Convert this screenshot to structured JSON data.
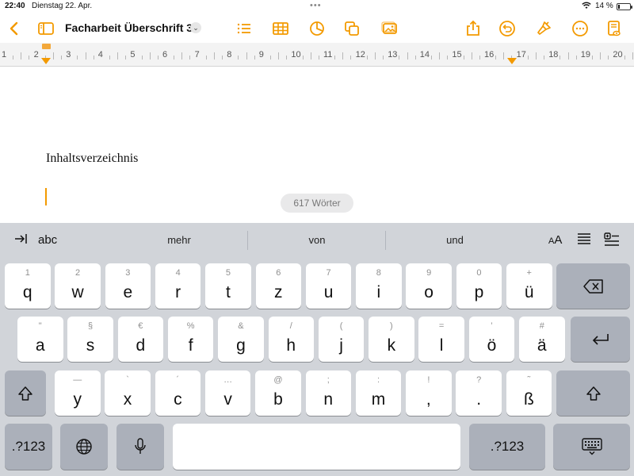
{
  "status": {
    "time": "22:40",
    "date": "Dienstag 22. Apr.",
    "battery": "14 %",
    "battery_level": 0.14
  },
  "toolbar": {
    "doc_title": "Facharbeit Überschrift 3"
  },
  "ruler": {
    "numbers": [
      "1",
      "2",
      "3",
      "4",
      "5",
      "6",
      "7",
      "8",
      "9",
      "10",
      "11",
      "12",
      "13",
      "14",
      "15",
      "16",
      "17",
      "18",
      "19",
      "20"
    ]
  },
  "document": {
    "heading": "Inhaltsverzeichnis",
    "word_count": "617 Wörter"
  },
  "keyboard": {
    "predict": {
      "abc": "abc",
      "suggestions": [
        "mehr",
        "von",
        "und"
      ],
      "font_size_label": "AA"
    },
    "row1": [
      {
        "hint": "1",
        "main": "q"
      },
      {
        "hint": "2",
        "main": "w"
      },
      {
        "hint": "3",
        "main": "e"
      },
      {
        "hint": "4",
        "main": "r"
      },
      {
        "hint": "5",
        "main": "t"
      },
      {
        "hint": "6",
        "main": "z"
      },
      {
        "hint": "7",
        "main": "u"
      },
      {
        "hint": "8",
        "main": "i"
      },
      {
        "hint": "9",
        "main": "o"
      },
      {
        "hint": "0",
        "main": "p"
      },
      {
        "hint": "+",
        "main": "ü"
      }
    ],
    "row2": [
      {
        "hint": "\"",
        "main": "a"
      },
      {
        "hint": "§",
        "main": "s"
      },
      {
        "hint": "€",
        "main": "d"
      },
      {
        "hint": "%",
        "main": "f"
      },
      {
        "hint": "&",
        "main": "g"
      },
      {
        "hint": "/",
        "main": "h"
      },
      {
        "hint": "(",
        "main": "j"
      },
      {
        "hint": ")",
        "main": "k"
      },
      {
        "hint": "=",
        "main": "l"
      },
      {
        "hint": "’",
        "main": "ö"
      },
      {
        "hint": "#",
        "main": "ä"
      }
    ],
    "row3": [
      {
        "hint": "—",
        "main": "y"
      },
      {
        "hint": "`",
        "main": "x"
      },
      {
        "hint": "´",
        "main": "c"
      },
      {
        "hint": "…",
        "main": "v"
      },
      {
        "hint": "@",
        "main": "b"
      },
      {
        "hint": ";",
        "main": "n"
      },
      {
        "hint": ":",
        "main": "m"
      },
      {
        "hint": "!",
        "main": ","
      },
      {
        "hint": "?",
        "main": "."
      },
      {
        "hint": "˜",
        "main": "ß"
      }
    ],
    "numbers_label": ".?123"
  }
}
